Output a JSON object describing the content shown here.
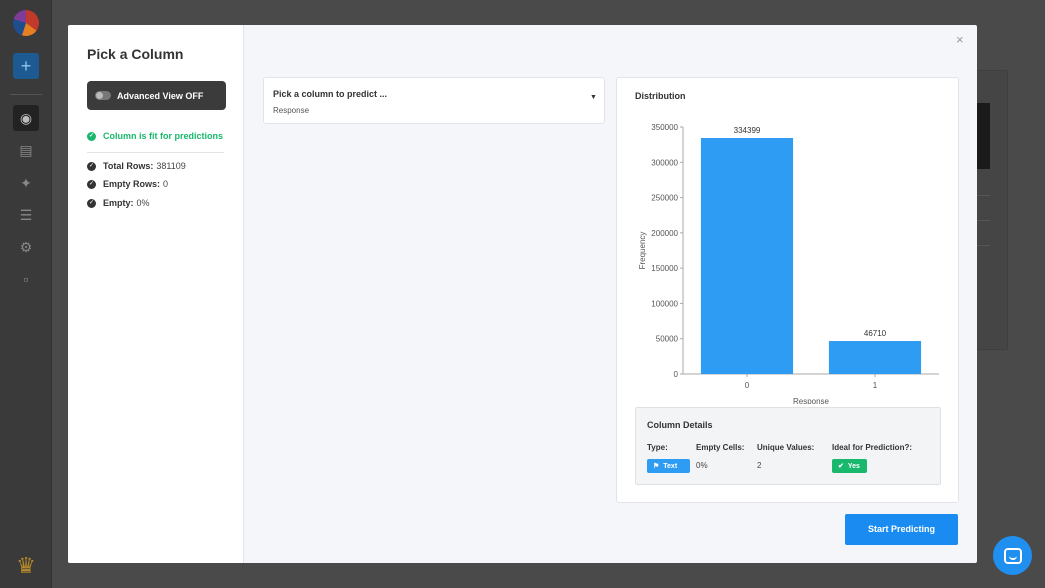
{
  "modal": {
    "title": "Pick a Column",
    "advanced_view_label": "Advanced View OFF",
    "fit_message": "Column is fit for predictions",
    "stats": [
      {
        "label": "Total Rows:",
        "value": "381109"
      },
      {
        "label": "Empty Rows:",
        "value": "0"
      },
      {
        "label": "Empty:",
        "value": "0%"
      }
    ],
    "close_label": "×",
    "select": {
      "label": "Pick a column to predict ...",
      "value": "Response"
    },
    "distribution_title": "Distribution",
    "details": {
      "title": "Column Details",
      "type_label": "Type:",
      "type_value": "Text",
      "empty_cells_label": "Empty Cells:",
      "empty_cells_value": "0%",
      "unique_values_label": "Unique Values:",
      "unique_values_value": "2",
      "ideal_label": "Ideal for Prediction?:",
      "ideal_value": "Yes"
    },
    "start_button": "Start Predicting"
  },
  "colors": {
    "accent": "#1a8cf1",
    "bar": "#2f9cf4",
    "success": "#19b86d"
  },
  "icons": {
    "close": "close-icon",
    "caret": "caret-down-icon",
    "check": "check-circle-icon",
    "chat": "chat-icon"
  },
  "chart_data": {
    "type": "bar",
    "categories": [
      "0",
      "1"
    ],
    "values": [
      334399,
      46710
    ],
    "data_labels": [
      "334399",
      "46710"
    ],
    "xlabel": "Response",
    "ylabel": "Frequency",
    "ylim": [
      0,
      350000
    ],
    "yticks": [
      "0",
      "50000",
      "100000",
      "150000",
      "200000",
      "250000",
      "300000",
      "350000"
    ],
    "grid": false
  }
}
